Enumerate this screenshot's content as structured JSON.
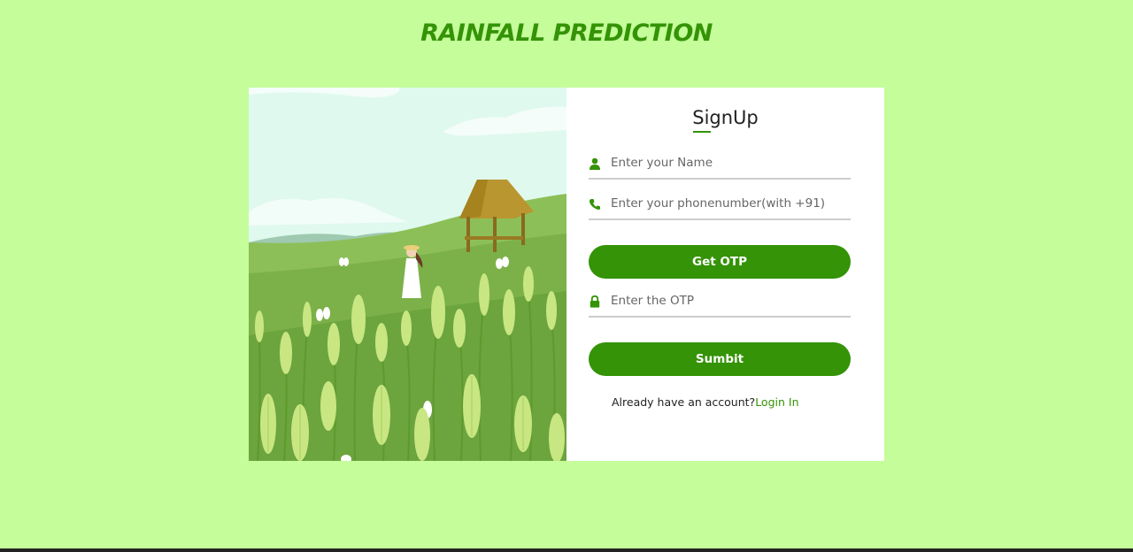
{
  "page": {
    "title": "RAINFALL PREDICTION"
  },
  "form": {
    "title": "SignUp",
    "name_placeholder": "Enter your Name",
    "phone_placeholder": "Enter your phonenumber(with +91)",
    "get_otp_label": "Get OTP",
    "otp_placeholder": "Enter the OTP",
    "submit_label": "Sumbit",
    "login_prompt": "Already have an account?",
    "login_link": "Login In"
  },
  "icons": {
    "name": "user-icon",
    "phone": "phone-icon",
    "otp": "lock-icon"
  },
  "colors": {
    "background": "#c4fd9a",
    "accent": "#349306",
    "card": "#ffffff"
  }
}
